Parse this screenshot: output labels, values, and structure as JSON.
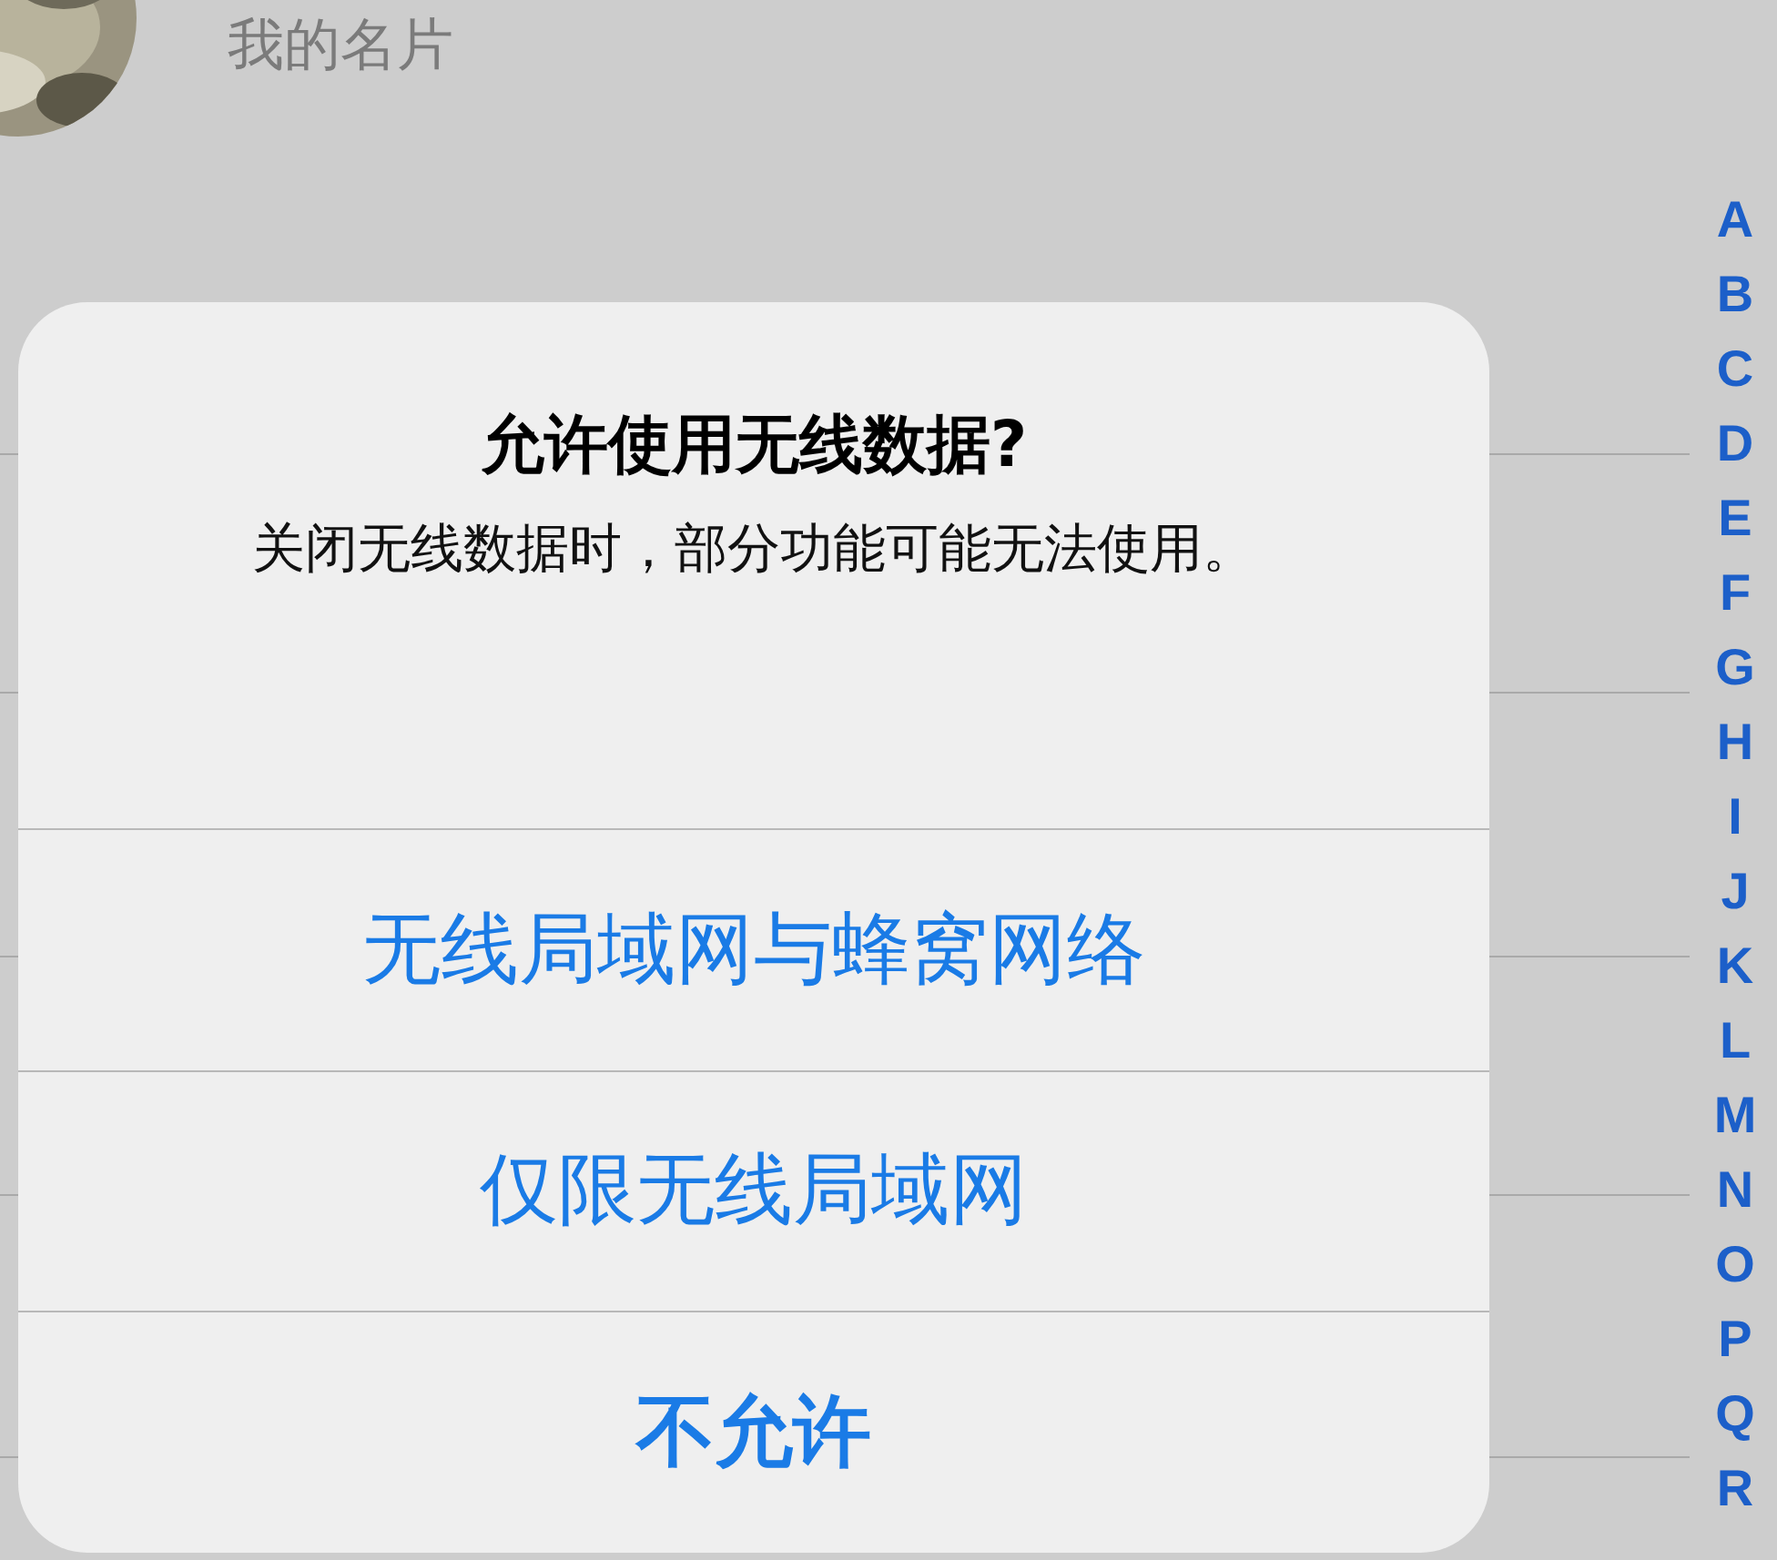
{
  "my_card": {
    "label": "我的名片"
  },
  "index": [
    "A",
    "B",
    "C",
    "D",
    "E",
    "F",
    "G",
    "H",
    "I",
    "J",
    "K",
    "L",
    "M",
    "N",
    "O",
    "P",
    "Q",
    "R"
  ],
  "alert": {
    "title": "允许使用无线数据?",
    "message": "关闭无线数据时，部分功能可能无法使用。",
    "actions": [
      {
        "label": "无线局域网与蜂窝网络",
        "kind": "default"
      },
      {
        "label": "仅限无线局域网",
        "kind": "default"
      },
      {
        "label": "不允许",
        "kind": "preferred"
      }
    ]
  }
}
